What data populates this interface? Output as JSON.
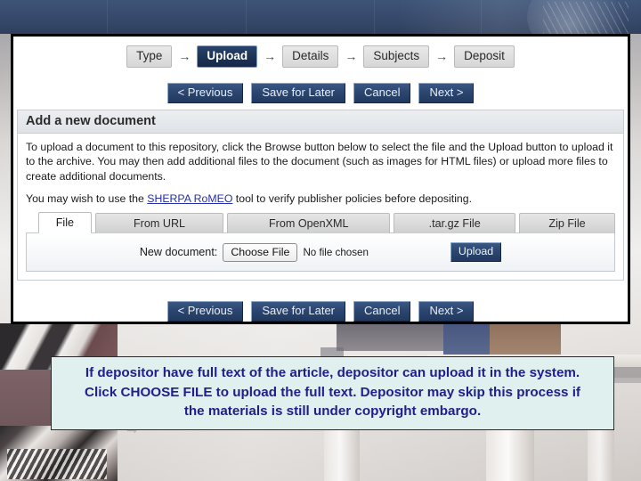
{
  "banner": {
    "name": "top-banner"
  },
  "wizard": {
    "steps": [
      {
        "label": "Type",
        "active": false
      },
      {
        "label": "Upload",
        "active": true
      },
      {
        "label": "Details",
        "active": false
      },
      {
        "label": "Subjects",
        "active": false
      },
      {
        "label": "Deposit",
        "active": false
      }
    ],
    "arrow": "→",
    "nav_buttons": [
      {
        "label": "< Previous"
      },
      {
        "label": "Save for Later"
      },
      {
        "label": "Cancel"
      },
      {
        "label": "Next >"
      }
    ]
  },
  "card": {
    "header": "Add a new document",
    "intro": "To upload a document to this repository, click the Browse button below to select the file and the Upload button to upload it to the archive. You may then add additional files to the document (such as images for HTML files) or upload more files to create additional documents.",
    "sherpa_prefix": "You may wish to use the ",
    "sherpa_link": "SHERPA RoMEO",
    "sherpa_suffix": " tool to verify publisher policies before depositing."
  },
  "tabs": [
    {
      "label": "File",
      "active": true
    },
    {
      "label": "From URL",
      "active": false
    },
    {
      "label": "From OpenXML",
      "active": false
    },
    {
      "label": ".tar.gz File",
      "active": false
    },
    {
      "label": "Zip File",
      "active": false
    }
  ],
  "upload_form": {
    "field_label": "New document:",
    "choose_file_label": "Choose File",
    "no_file_text": "No file chosen",
    "upload_label": "Upload"
  },
  "caption": {
    "line1": "If depositor have full text of the article, depositor can upload it in the system.",
    "line2": "Click CHOOSE FILE to upload the full text. Depositor may skip this process if",
    "line3": "the materials is still under copyright embargo."
  },
  "colors": {
    "banner_blue": "#37496b",
    "active_step_navy": "#1d3456",
    "nav_button_blue": "#2b4670",
    "link_blue": "#2530a8",
    "caption_bg": "#dff0ef",
    "caption_text": "#20208c"
  }
}
